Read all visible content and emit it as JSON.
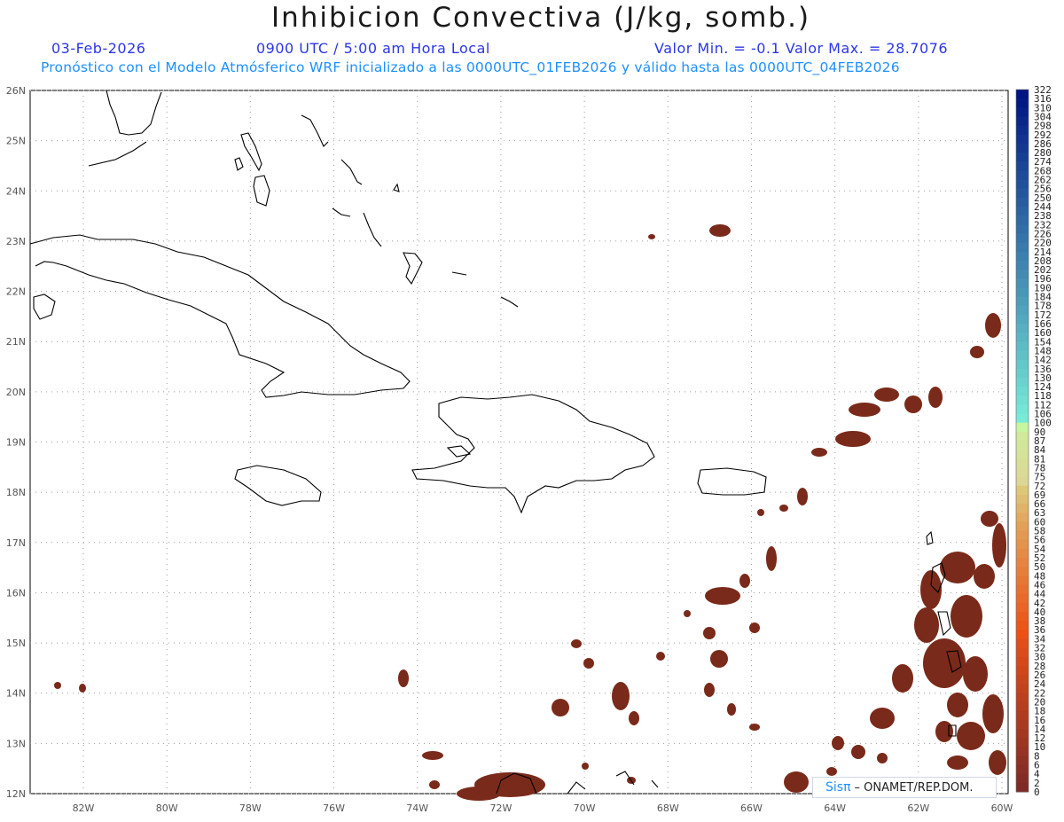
{
  "title": "Inhibicion Convectiva (J/kg, somb.)",
  "header": {
    "date": "03-Feb-2026",
    "time": "0900 UTC / 5:00 am Hora Local",
    "minmax": "Valor Min. = -0.1  Valor Max. = 28.7076",
    "model_info": "Pronóstico con el Modelo Atmósferico WRF inicializado a las 0000UTC_01FEB2026 y válido hasta las  0000UTC_04FEB2026"
  },
  "map": {
    "lat_labels": [
      "26N",
      "25N",
      "24N",
      "23N",
      "22N",
      "21N",
      "20N",
      "19N",
      "18N",
      "17N",
      "16N",
      "15N",
      "14N",
      "13N",
      "12N"
    ],
    "lon_labels": [
      "82W",
      "80W",
      "78W",
      "76W",
      "74W",
      "72W",
      "70W",
      "68W",
      "66W",
      "64W",
      "62W",
      "60W"
    ],
    "field_color": "#7a2a1a",
    "coast_color": "#000000",
    "grid_color": "#9a9a9a"
  },
  "colorbar": {
    "labels": [
      "322",
      "316",
      "310",
      "304",
      "298",
      "292",
      "286",
      "280",
      "274",
      "268",
      "262",
      "256",
      "250",
      "244",
      "238",
      "232",
      "226",
      "220",
      "214",
      "208",
      "202",
      "196",
      "190",
      "184",
      "178",
      "172",
      "166",
      "160",
      "154",
      "148",
      "142",
      "136",
      "130",
      "124",
      "118",
      "112",
      "106",
      "100",
      "90",
      "87",
      "84",
      "81",
      "78",
      "75",
      "72",
      "69",
      "66",
      "63",
      "60",
      "58",
      "56",
      "54",
      "52",
      "50",
      "48",
      "46",
      "44",
      "42",
      "40",
      "38",
      "36",
      "34",
      "32",
      "30",
      "28",
      "26",
      "24",
      "22",
      "20",
      "18",
      "16",
      "14",
      "12",
      "10",
      "8",
      "6",
      "4",
      "2",
      "0"
    ]
  },
  "logo": {
    "brand": "Sisπ",
    "text": "– ONAMET/REP.DOM."
  }
}
